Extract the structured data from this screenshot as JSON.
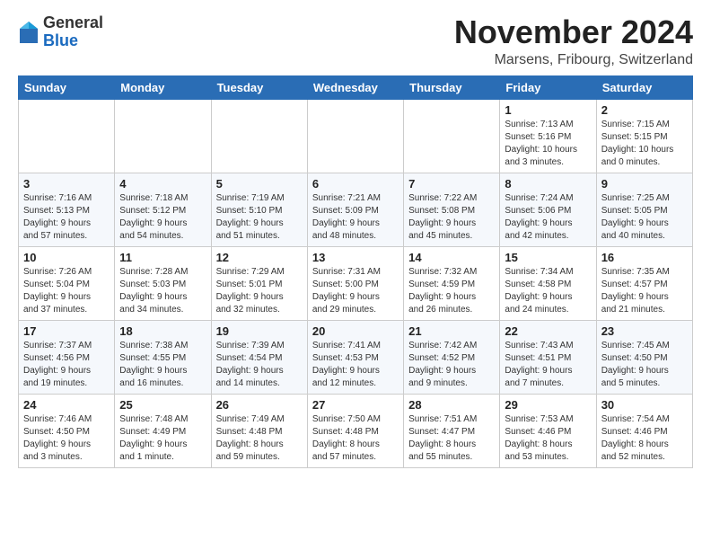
{
  "logo": {
    "general": "General",
    "blue": "Blue"
  },
  "header": {
    "month": "November 2024",
    "location": "Marsens, Fribourg, Switzerland"
  },
  "weekdays": [
    "Sunday",
    "Monday",
    "Tuesday",
    "Wednesday",
    "Thursday",
    "Friday",
    "Saturday"
  ],
  "weeks": [
    [
      {
        "day": "",
        "info": ""
      },
      {
        "day": "",
        "info": ""
      },
      {
        "day": "",
        "info": ""
      },
      {
        "day": "",
        "info": ""
      },
      {
        "day": "",
        "info": ""
      },
      {
        "day": "1",
        "info": "Sunrise: 7:13 AM\nSunset: 5:16 PM\nDaylight: 10 hours\nand 3 minutes."
      },
      {
        "day": "2",
        "info": "Sunrise: 7:15 AM\nSunset: 5:15 PM\nDaylight: 10 hours\nand 0 minutes."
      }
    ],
    [
      {
        "day": "3",
        "info": "Sunrise: 7:16 AM\nSunset: 5:13 PM\nDaylight: 9 hours\nand 57 minutes."
      },
      {
        "day": "4",
        "info": "Sunrise: 7:18 AM\nSunset: 5:12 PM\nDaylight: 9 hours\nand 54 minutes."
      },
      {
        "day": "5",
        "info": "Sunrise: 7:19 AM\nSunset: 5:10 PM\nDaylight: 9 hours\nand 51 minutes."
      },
      {
        "day": "6",
        "info": "Sunrise: 7:21 AM\nSunset: 5:09 PM\nDaylight: 9 hours\nand 48 minutes."
      },
      {
        "day": "7",
        "info": "Sunrise: 7:22 AM\nSunset: 5:08 PM\nDaylight: 9 hours\nand 45 minutes."
      },
      {
        "day": "8",
        "info": "Sunrise: 7:24 AM\nSunset: 5:06 PM\nDaylight: 9 hours\nand 42 minutes."
      },
      {
        "day": "9",
        "info": "Sunrise: 7:25 AM\nSunset: 5:05 PM\nDaylight: 9 hours\nand 40 minutes."
      }
    ],
    [
      {
        "day": "10",
        "info": "Sunrise: 7:26 AM\nSunset: 5:04 PM\nDaylight: 9 hours\nand 37 minutes."
      },
      {
        "day": "11",
        "info": "Sunrise: 7:28 AM\nSunset: 5:03 PM\nDaylight: 9 hours\nand 34 minutes."
      },
      {
        "day": "12",
        "info": "Sunrise: 7:29 AM\nSunset: 5:01 PM\nDaylight: 9 hours\nand 32 minutes."
      },
      {
        "day": "13",
        "info": "Sunrise: 7:31 AM\nSunset: 5:00 PM\nDaylight: 9 hours\nand 29 minutes."
      },
      {
        "day": "14",
        "info": "Sunrise: 7:32 AM\nSunset: 4:59 PM\nDaylight: 9 hours\nand 26 minutes."
      },
      {
        "day": "15",
        "info": "Sunrise: 7:34 AM\nSunset: 4:58 PM\nDaylight: 9 hours\nand 24 minutes."
      },
      {
        "day": "16",
        "info": "Sunrise: 7:35 AM\nSunset: 4:57 PM\nDaylight: 9 hours\nand 21 minutes."
      }
    ],
    [
      {
        "day": "17",
        "info": "Sunrise: 7:37 AM\nSunset: 4:56 PM\nDaylight: 9 hours\nand 19 minutes."
      },
      {
        "day": "18",
        "info": "Sunrise: 7:38 AM\nSunset: 4:55 PM\nDaylight: 9 hours\nand 16 minutes."
      },
      {
        "day": "19",
        "info": "Sunrise: 7:39 AM\nSunset: 4:54 PM\nDaylight: 9 hours\nand 14 minutes."
      },
      {
        "day": "20",
        "info": "Sunrise: 7:41 AM\nSunset: 4:53 PM\nDaylight: 9 hours\nand 12 minutes."
      },
      {
        "day": "21",
        "info": "Sunrise: 7:42 AM\nSunset: 4:52 PM\nDaylight: 9 hours\nand 9 minutes."
      },
      {
        "day": "22",
        "info": "Sunrise: 7:43 AM\nSunset: 4:51 PM\nDaylight: 9 hours\nand 7 minutes."
      },
      {
        "day": "23",
        "info": "Sunrise: 7:45 AM\nSunset: 4:50 PM\nDaylight: 9 hours\nand 5 minutes."
      }
    ],
    [
      {
        "day": "24",
        "info": "Sunrise: 7:46 AM\nSunset: 4:50 PM\nDaylight: 9 hours\nand 3 minutes."
      },
      {
        "day": "25",
        "info": "Sunrise: 7:48 AM\nSunset: 4:49 PM\nDaylight: 9 hours\nand 1 minute."
      },
      {
        "day": "26",
        "info": "Sunrise: 7:49 AM\nSunset: 4:48 PM\nDaylight: 8 hours\nand 59 minutes."
      },
      {
        "day": "27",
        "info": "Sunrise: 7:50 AM\nSunset: 4:48 PM\nDaylight: 8 hours\nand 57 minutes."
      },
      {
        "day": "28",
        "info": "Sunrise: 7:51 AM\nSunset: 4:47 PM\nDaylight: 8 hours\nand 55 minutes."
      },
      {
        "day": "29",
        "info": "Sunrise: 7:53 AM\nSunset: 4:46 PM\nDaylight: 8 hours\nand 53 minutes."
      },
      {
        "day": "30",
        "info": "Sunrise: 7:54 AM\nSunset: 4:46 PM\nDaylight: 8 hours\nand 52 minutes."
      }
    ]
  ]
}
